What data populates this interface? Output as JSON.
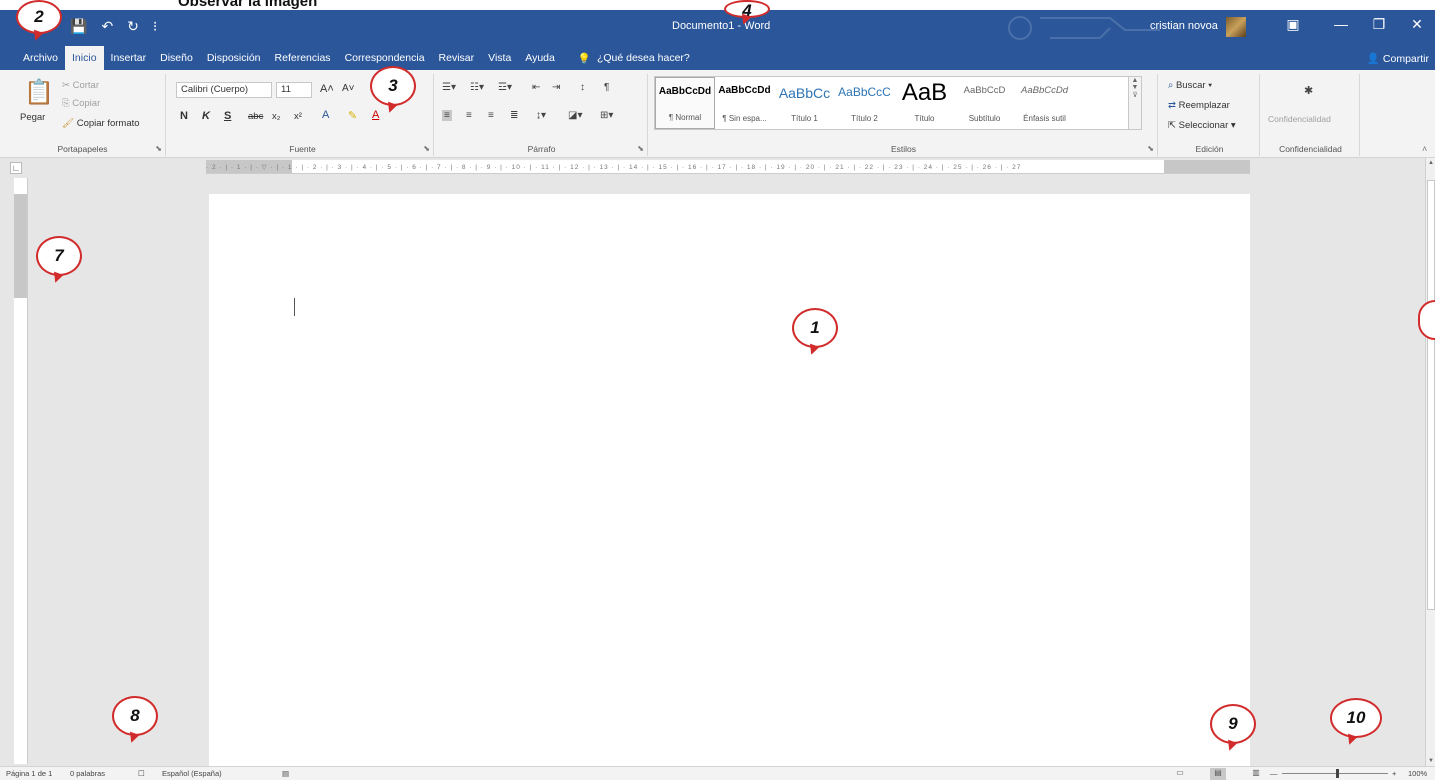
{
  "page_heading": "Observar la imagen",
  "titlebar": {
    "doc_title": "Documento1 - Word",
    "user": "cristian novoa",
    "qat_save": "💾",
    "qat_undo": "↶",
    "qat_redo": "↻",
    "qat_more": "⁝",
    "win_ribbon_options": "▣",
    "win_minimize": "—",
    "win_restore": "❐",
    "win_close": "✕"
  },
  "tabs": [
    {
      "label": "Archivo"
    },
    {
      "label": "Inicio"
    },
    {
      "label": "Insertar"
    },
    {
      "label": "Diseño"
    },
    {
      "label": "Disposición"
    },
    {
      "label": "Referencias"
    },
    {
      "label": "Correspondencia"
    },
    {
      "label": "Revisar"
    },
    {
      "label": "Vista"
    },
    {
      "label": "Ayuda"
    }
  ],
  "tell_me": "¿Qué desea hacer?",
  "share": "Compartir",
  "clipboard": {
    "paste": "Pegar",
    "cut": "Cortar",
    "copy": "Copiar",
    "format_painter": "Copiar formato",
    "group_label": "Portapapeles"
  },
  "font": {
    "name": "Calibri (Cuerpo)",
    "size": "11",
    "bold": "N",
    "italic": "K",
    "underline": "S",
    "strike": "abc",
    "subscript": "x₂",
    "superscript": "x²",
    "grow": "A˄",
    "shrink": "A˅",
    "group_label": "Fuente"
  },
  "paragraph": {
    "group_label": "Párrafo"
  },
  "styles": {
    "items": [
      {
        "sample": "AaBbCcDd",
        "name": "¶ Normal"
      },
      {
        "sample": "AaBbCcDd",
        "name": "¶ Sin espa..."
      },
      {
        "sample": "AaBbCc",
        "name": "Título 1"
      },
      {
        "sample": "AaBbCcC",
        "name": "Título 2"
      },
      {
        "sample": "AaB",
        "name": "Título"
      },
      {
        "sample": "AaBbCcD",
        "name": "Subtítulo"
      },
      {
        "sample": "AaBbCcDd",
        "name": "Énfasis sutil"
      }
    ],
    "group_label": "Estilos"
  },
  "editing": {
    "find": "Buscar",
    "replace": "Reemplazar",
    "select": "Seleccionar",
    "group_label": "Edición"
  },
  "sensitivity": {
    "button": "Confidencialidad",
    "group_label": "Confidencialidad"
  },
  "ruler": {
    "ticks": "· 2 · | · 1 · | · ▽ · | · 1 · | · 2 · | · 3 · | · 4 · | · 5 · | · 6 · | · 7 · | · 8 · | · 9 · | · 10 · | · 11 · | · 12 · | · 13 · | · 14 · | · 15 · | · 16 · | · 17 · | · 18 · | · 19 · | · 20 · | · 21 · | · 22 · | · 23 · | · 24 · | · 25 · | · 26 · | · 27"
  },
  "statusbar": {
    "page": "Página 1 de 1",
    "words": "0 palabras",
    "language": "Español (España)",
    "zoom": "100%"
  },
  "callouts": [
    "1",
    "2",
    "3",
    "4",
    "7",
    "8",
    "9",
    "10"
  ]
}
